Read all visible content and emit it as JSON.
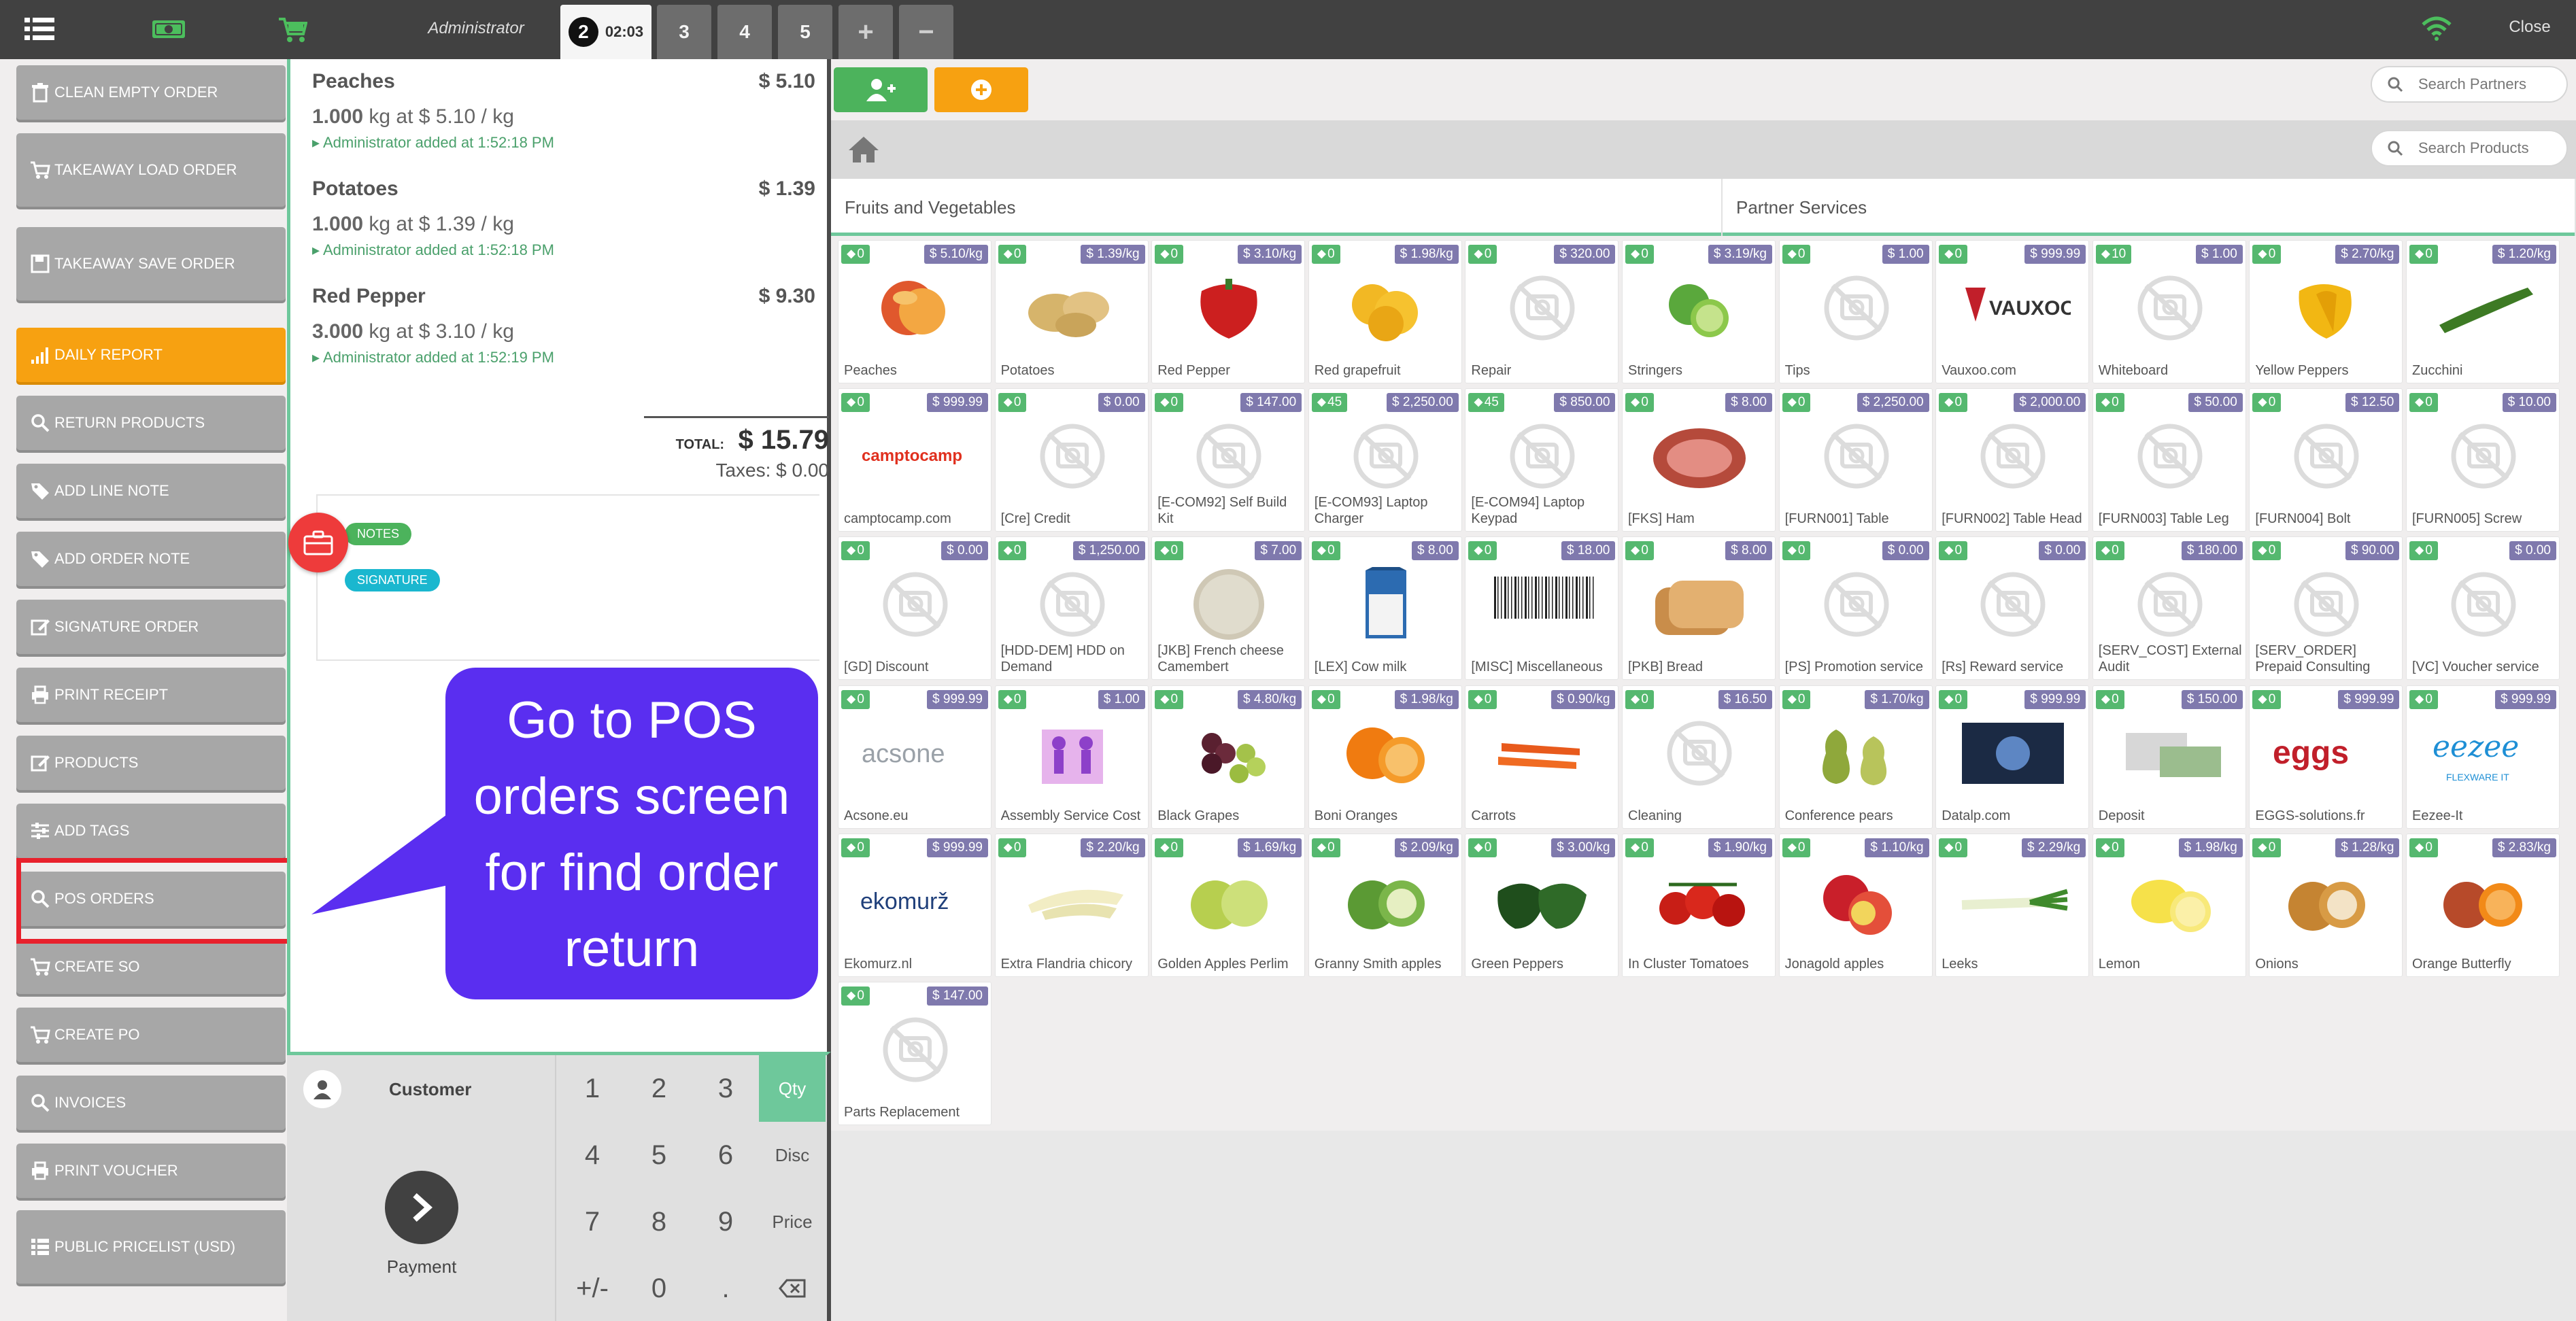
{
  "topbar": {
    "user": "Administrator",
    "active_order": {
      "number": "2",
      "time": "02:03"
    },
    "orders": [
      "3",
      "4",
      "5"
    ],
    "add_label": "+",
    "remove_label": "−",
    "close_label": "Close"
  },
  "actions": [
    {
      "label": "CLEAN EMPTY ORDER",
      "icon": "trash-icon"
    },
    {
      "label": "TAKEAWAY LOAD ORDER",
      "icon": "cart-icon"
    },
    {
      "label": "TAKEAWAY SAVE ORDER",
      "icon": "save-icon"
    },
    {
      "label": "DAILY REPORT",
      "icon": "signal-icon"
    },
    {
      "label": "RETURN PRODUCTS",
      "icon": "search-icon"
    },
    {
      "label": "ADD LINE NOTE",
      "icon": "tag-icon"
    },
    {
      "label": "ADD ORDER NOTE",
      "icon": "tag-icon"
    },
    {
      "label": "SIGNATURE ORDER",
      "icon": "edit-icon"
    },
    {
      "label": "PRINT RECEIPT",
      "icon": "print-icon"
    },
    {
      "label": "PRODUCTS",
      "icon": "edit-icon"
    },
    {
      "label": "ADD TAGS",
      "icon": "sliders-icon"
    },
    {
      "label": "POS ORDERS",
      "icon": "search-icon"
    },
    {
      "label": "CREATE SO",
      "icon": "cart-icon"
    },
    {
      "label": "CREATE PO",
      "icon": "cart-icon"
    },
    {
      "label": "INVOICES",
      "icon": "search-icon"
    },
    {
      "label": "PRINT VOUCHER",
      "icon": "print-icon"
    },
    {
      "label": "PUBLIC PRICELIST (USD)",
      "icon": "list-icon"
    }
  ],
  "order": {
    "lines": [
      {
        "name": "Peaches",
        "price": "$ 5.10",
        "qty": "1.000",
        "detail": " kg at $ 5.10 / kg",
        "added": "Administrator added at 1:52:18 PM"
      },
      {
        "name": "Potatoes",
        "price": "$ 1.39",
        "qty": "1.000",
        "detail": " kg at $ 1.39 / kg",
        "added": "Administrator added at 1:52:18 PM"
      },
      {
        "name": "Red Pepper",
        "price": "$ 9.30",
        "qty": "3.000",
        "detail": " kg at $ 3.10 / kg",
        "added": "Administrator added at 1:52:19 PM"
      }
    ],
    "total_label": "TOTAL:",
    "total": "$ 15.79",
    "taxes": "Taxes: $ 0.00",
    "notes_pill": "NOTES",
    "signature_pill": "SIGNATURE"
  },
  "callout": {
    "text": "Go to POS orders screen for find order return"
  },
  "numpad": {
    "customer_label": "Customer",
    "payment_label": "Payment",
    "keys": [
      "1",
      "2",
      "3",
      "4",
      "5",
      "6",
      "7",
      "8",
      "9",
      "+/-",
      "0",
      "."
    ],
    "modes": [
      "Qty",
      "Disc",
      "Price"
    ],
    "active_mode": "Qty"
  },
  "search": {
    "partners_placeholder": "Search Partners",
    "products_placeholder": "Search Products"
  },
  "categories": [
    "Fruits and Vegetables",
    "Partner Services"
  ],
  "products": [
    {
      "name": "Peaches",
      "price": "$ 5.10/kg",
      "tag": "0",
      "img": "peach"
    },
    {
      "name": "Potatoes",
      "price": "$ 1.39/kg",
      "tag": "0",
      "img": "potato"
    },
    {
      "name": "Red Pepper",
      "price": "$ 3.10/kg",
      "tag": "0",
      "img": "redpepper"
    },
    {
      "name": "Red grapefruit",
      "price": "$ 1.98/kg",
      "tag": "0",
      "img": "grapefruit"
    },
    {
      "name": "Repair",
      "price": "$ 320.00",
      "tag": "0",
      "img": "none"
    },
    {
      "name": "Stringers",
      "price": "$ 3.19/kg",
      "tag": "0",
      "img": "lime"
    },
    {
      "name": "Tips",
      "price": "$ 1.00",
      "tag": "0",
      "img": "none"
    },
    {
      "name": "Vauxoo.com",
      "price": "$ 999.99",
      "tag": "0",
      "img": "vauxoo"
    },
    {
      "name": "Whiteboard",
      "price": "$ 1.00",
      "tag": "10",
      "img": "none"
    },
    {
      "name": "Yellow Peppers",
      "price": "$ 2.70/kg",
      "tag": "0",
      "img": "yellowpepper"
    },
    {
      "name": "Zucchini",
      "price": "$ 1.20/kg",
      "tag": "0",
      "img": "zucchini"
    },
    {
      "name": "camptocamp.com",
      "price": "$ 999.99",
      "tag": "0",
      "img": "camptocamp"
    },
    {
      "name": "[Cre] Credit",
      "price": "$ 0.00",
      "tag": "0",
      "img": "none"
    },
    {
      "name": "[E-COM92] Self Build Kit",
      "price": "$ 147.00",
      "tag": "0",
      "img": "none"
    },
    {
      "name": "[E-COM93] Laptop Charger",
      "price": "$ 2,250.00",
      "tag": "45",
      "img": "none"
    },
    {
      "name": "[E-COM94] Laptop Keypad",
      "price": "$ 850.00",
      "tag": "45",
      "img": "none"
    },
    {
      "name": "[FKS] Ham",
      "price": "$ 8.00",
      "tag": "0",
      "img": "ham"
    },
    {
      "name": "[FURN001] Table",
      "price": "$ 2,250.00",
      "tag": "0",
      "img": "none"
    },
    {
      "name": "[FURN002] Table Head",
      "price": "$ 2,000.00",
      "tag": "0",
      "img": "none"
    },
    {
      "name": "[FURN003] Table Leg",
      "price": "$ 50.00",
      "tag": "0",
      "img": "none"
    },
    {
      "name": "[FURN004] Bolt",
      "price": "$ 12.50",
      "tag": "0",
      "img": "none"
    },
    {
      "name": "[FURN005] Screw",
      "price": "$ 10.00",
      "tag": "0",
      "img": "none"
    },
    {
      "name": "[GD] Discount",
      "price": "$ 0.00",
      "tag": "0",
      "img": "none"
    },
    {
      "name": "[HDD-DEM] HDD on Demand",
      "price": "$ 1,250.00",
      "tag": "0",
      "img": "none"
    },
    {
      "name": "[JKB] French cheese Camembert",
      "price": "$ 7.00",
      "tag": "0",
      "img": "cheese"
    },
    {
      "name": "[LEX] Cow milk",
      "price": "$ 8.00",
      "tag": "0",
      "img": "milk"
    },
    {
      "name": "[MISC] Miscellaneous",
      "price": "$ 18.00",
      "tag": "0",
      "img": "barcode"
    },
    {
      "name": "[PKB] Bread",
      "price": "$ 8.00",
      "tag": "0",
      "img": "bread"
    },
    {
      "name": "[PS] Promotion service",
      "price": "$ 0.00",
      "tag": "0",
      "img": "none"
    },
    {
      "name": "[Rs] Reward service",
      "price": "$ 0.00",
      "tag": "0",
      "img": "none"
    },
    {
      "name": "[SERV_COST] External Audit",
      "price": "$ 180.00",
      "tag": "0",
      "img": "none"
    },
    {
      "name": "[SERV_ORDER] Prepaid Consulting",
      "price": "$ 90.00",
      "tag": "0",
      "img": "none"
    },
    {
      "name": "[VC] Voucher service",
      "price": "$ 0.00",
      "tag": "0",
      "img": "none"
    },
    {
      "name": "Acsone.eu",
      "price": "$ 999.99",
      "tag": "0",
      "img": "acsone"
    },
    {
      "name": "Assembly Service Cost",
      "price": "$ 1.00",
      "tag": "0",
      "img": "assembly"
    },
    {
      "name": "Black Grapes",
      "price": "$ 4.80/kg",
      "tag": "0",
      "img": "grapes"
    },
    {
      "name": "Boni Oranges",
      "price": "$ 1.98/kg",
      "tag": "0",
      "img": "orange"
    },
    {
      "name": "Carrots",
      "price": "$ 0.90/kg",
      "tag": "0",
      "img": "carrot"
    },
    {
      "name": "Cleaning",
      "price": "$ 16.50",
      "tag": "0",
      "img": "none"
    },
    {
      "name": "Conference pears",
      "price": "$ 1.70/kg",
      "tag": "0",
      "img": "pear"
    },
    {
      "name": "Datalp.com",
      "price": "$ 999.99",
      "tag": "0",
      "img": "datalp"
    },
    {
      "name": "Deposit",
      "price": "$ 150.00",
      "tag": "0",
      "img": "deposit"
    },
    {
      "name": "EGGS-solutions.fr",
      "price": "$ 999.99",
      "tag": "0",
      "img": "eggs"
    },
    {
      "name": "Eezee-It",
      "price": "$ 999.99",
      "tag": "0",
      "img": "eezee"
    },
    {
      "name": "Ekomurz.nl",
      "price": "$ 999.99",
      "tag": "0",
      "img": "ekomurz"
    },
    {
      "name": "Extra Flandria chicory",
      "price": "$ 2.20/kg",
      "tag": "0",
      "img": "chicory"
    },
    {
      "name": "Golden Apples Perlim",
      "price": "$ 1.69/kg",
      "tag": "0",
      "img": "goldenapple"
    },
    {
      "name": "Granny Smith apples",
      "price": "$ 2.09/kg",
      "tag": "0",
      "img": "grannyapple"
    },
    {
      "name": "Green Peppers",
      "price": "$ 3.00/kg",
      "tag": "0",
      "img": "greenpepper"
    },
    {
      "name": "In Cluster Tomatoes",
      "price": "$ 1.90/kg",
      "tag": "0",
      "img": "tomato"
    },
    {
      "name": "Jonagold apples",
      "price": "$ 1.10/kg",
      "tag": "0",
      "img": "redapple"
    },
    {
      "name": "Leeks",
      "price": "$ 2.29/kg",
      "tag": "0",
      "img": "leek"
    },
    {
      "name": "Lemon",
      "price": "$ 1.98/kg",
      "tag": "0",
      "img": "lemon"
    },
    {
      "name": "Onions",
      "price": "$ 1.28/kg",
      "tag": "0",
      "img": "onion"
    },
    {
      "name": "Orange Butterfly",
      "price": "$ 2.83/kg",
      "tag": "0",
      "img": "orangebutterfly"
    },
    {
      "name": "Parts Replacement",
      "price": "$ 147.00",
      "tag": "0",
      "img": "none"
    }
  ],
  "colors": {
    "topbar": "#414141",
    "accent_green": "#6ec89b",
    "orange": "#f7a111",
    "callout": "#5a2ef0",
    "highlight": "#e8212c",
    "tag_green": "#55b86f",
    "price_purple": "#7f79ad"
  }
}
